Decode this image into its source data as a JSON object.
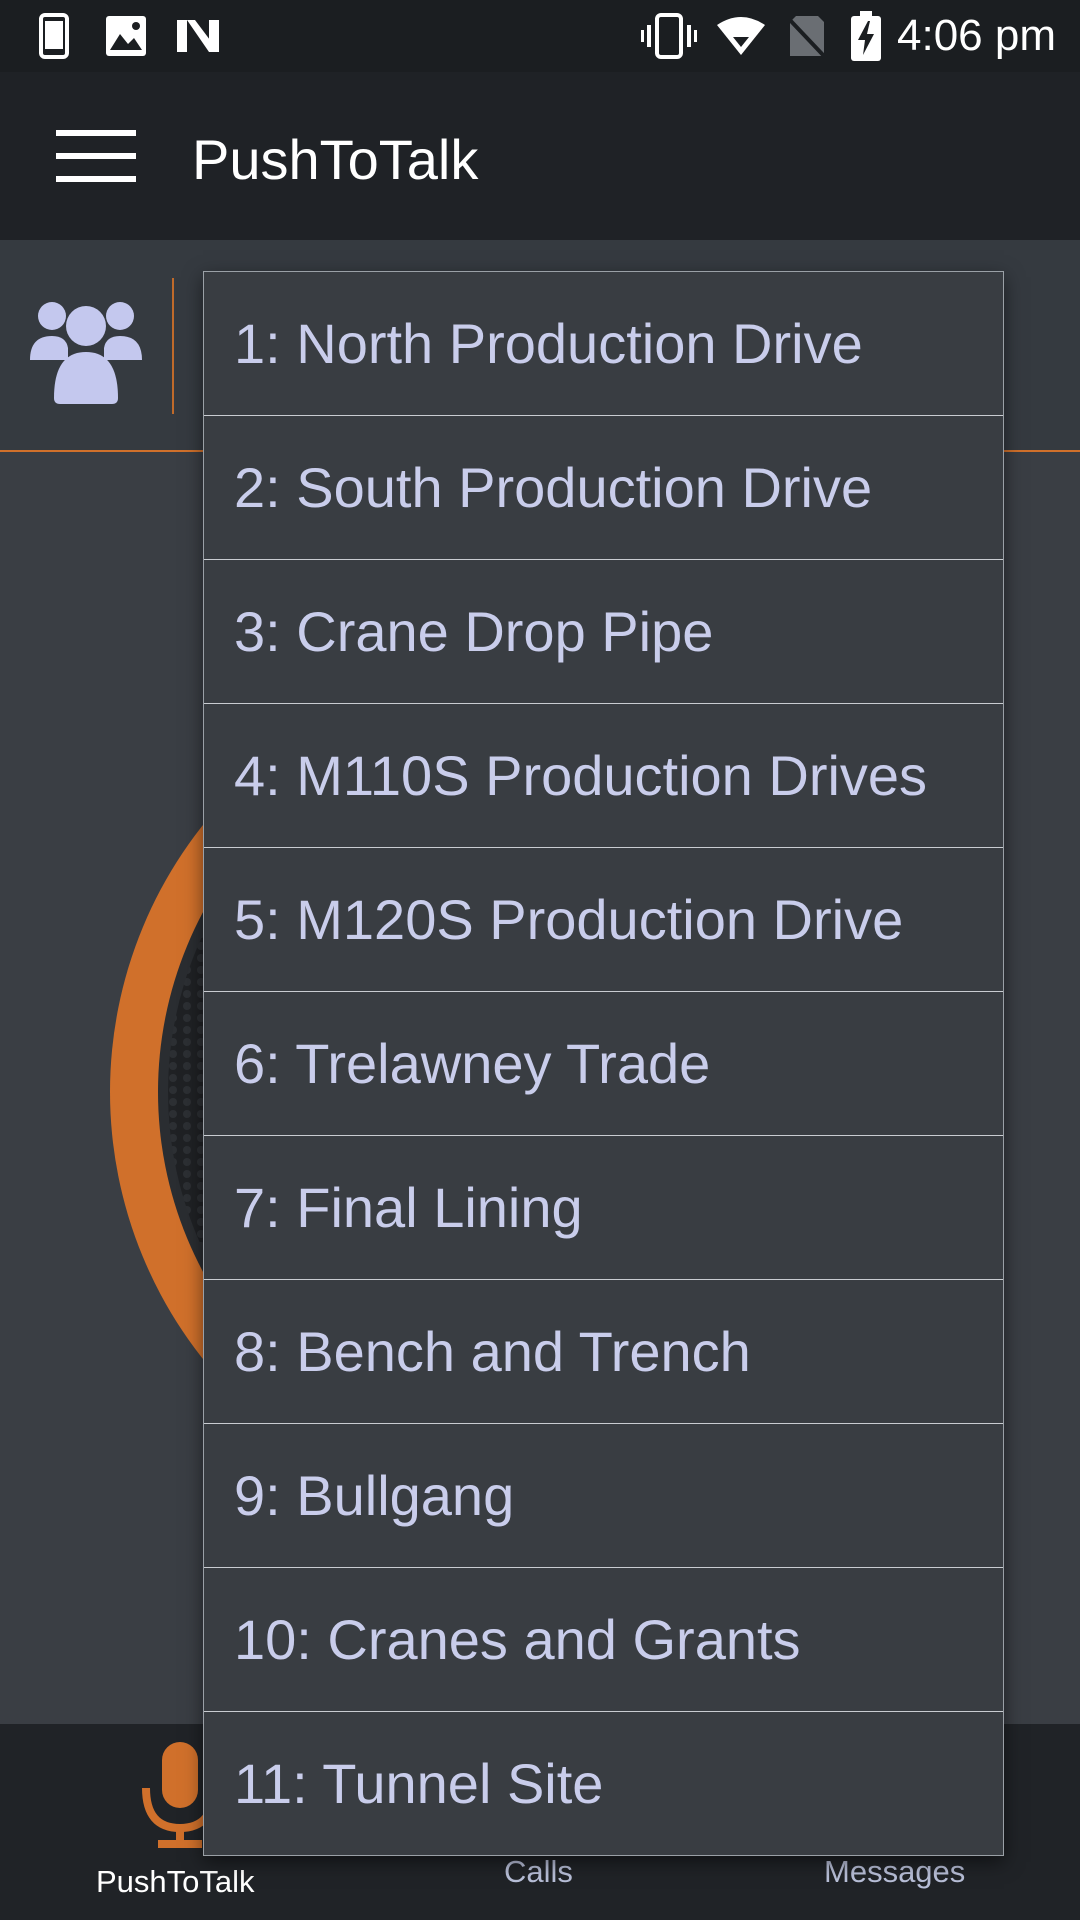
{
  "status_bar": {
    "time": "4:06 pm",
    "icons": [
      "phone-icon",
      "image-icon",
      "n-logo-icon",
      "vibrate-icon",
      "wifi-icon",
      "no-sim-icon",
      "battery-charging-icon"
    ]
  },
  "app_bar": {
    "title": "PushToTalk",
    "menu_icon": "hamburger-menu-icon"
  },
  "group_bar": {
    "icon": "group-icon"
  },
  "dropdown": {
    "items": [
      "1: North Production Drive",
      "2: South Production Drive",
      "3: Crane Drop Pipe",
      "4: M110S Production Drives",
      "5: M120S Production Drive",
      "6: Trelawney Trade",
      "7: Final Lining",
      "8: Bench and Trench",
      "9: Bullgang",
      "10: Cranes and Grants",
      "11: Tunnel Site"
    ]
  },
  "bottom_nav": {
    "ptt_label": "PushToTalk",
    "calls_label": "Calls",
    "messages_label": "Messages"
  },
  "colors": {
    "accent": "#d0702b",
    "dropdown_text": "#c9cdeb",
    "group_icon": "#c4c8ee"
  }
}
